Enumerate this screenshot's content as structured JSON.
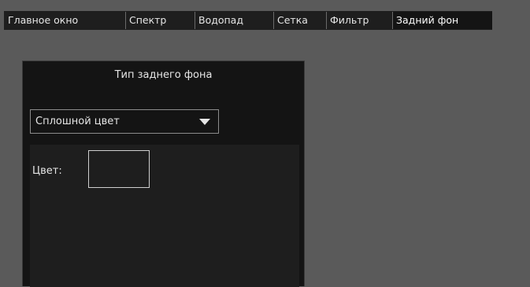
{
  "tabs": [
    {
      "label": "Главное окно"
    },
    {
      "label": "Спектр"
    },
    {
      "label": "Водопад"
    },
    {
      "label": "Сетка"
    },
    {
      "label": "Фильтр"
    },
    {
      "label": "Задний фон",
      "active": true
    }
  ],
  "background_panel": {
    "title": "Тип заднего фона",
    "type_select": {
      "value": "Сплошной цвет"
    },
    "color_label": "Цвет:",
    "color_value": "#1e1e1e"
  },
  "colors": {
    "window_bg": "#5a5a5a",
    "panel_bg": "#141414",
    "subpanel_bg": "#1e1e1e",
    "text": "#e6e6e6"
  }
}
